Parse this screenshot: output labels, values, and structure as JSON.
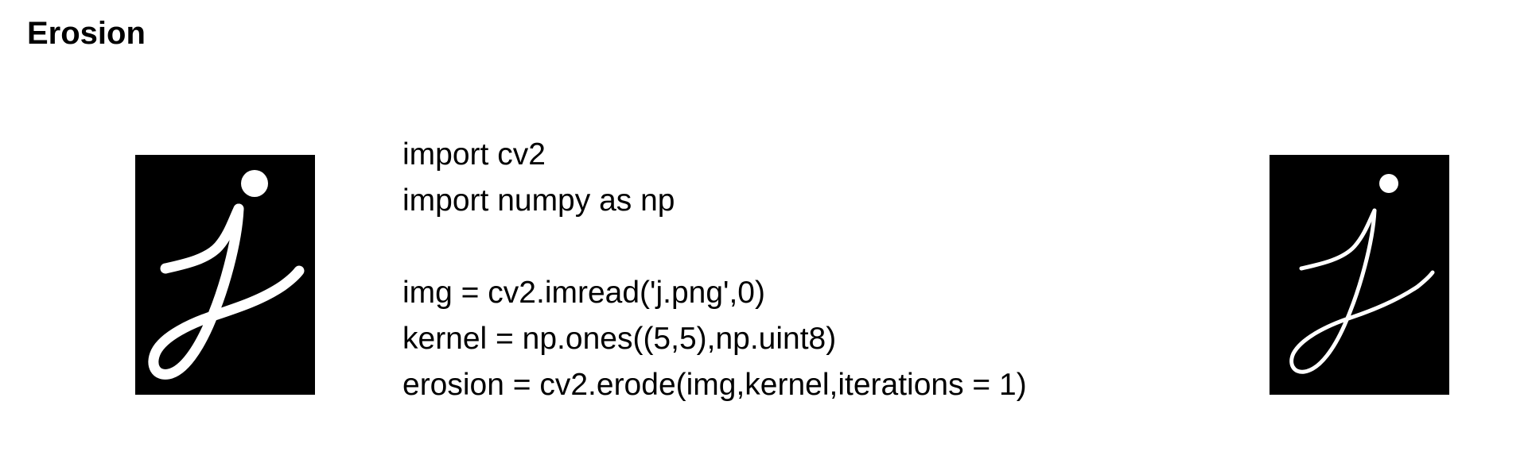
{
  "slide": {
    "title": "Erosion"
  },
  "images": {
    "original": {
      "description_icon": "letter-j-bold-icon",
      "background": "#000000",
      "stroke": "#ffffff"
    },
    "eroded": {
      "description_icon": "letter-j-thin-icon",
      "background": "#000000",
      "stroke": "#ffffff"
    }
  },
  "code": {
    "lines": [
      "import cv2",
      "import numpy as np",
      "",
      "img = cv2.imread('j.png',0)",
      "kernel = np.ones((5,5),np.uint8)",
      "erosion = cv2.erode(img,kernel,iterations = 1)"
    ]
  }
}
